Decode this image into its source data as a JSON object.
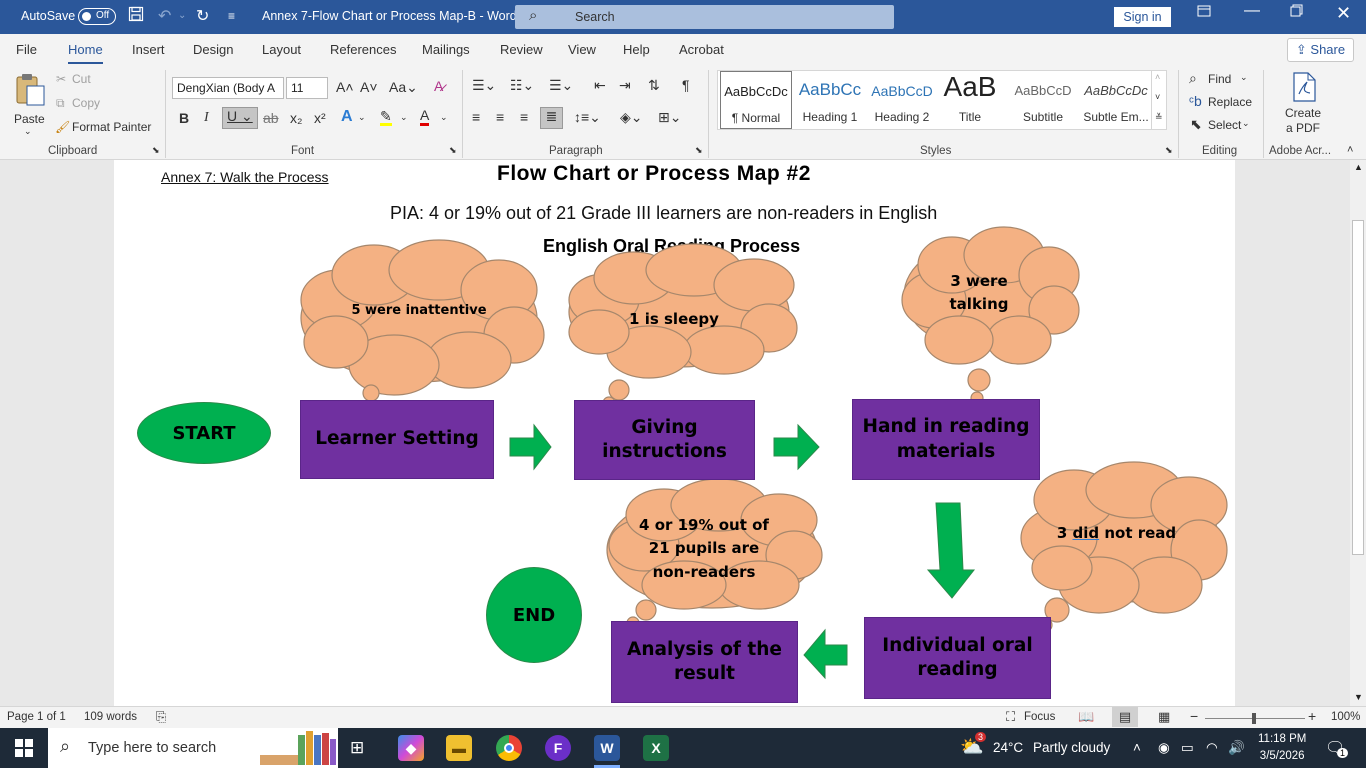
{
  "titlebar": {
    "autosave_label": "AutoSave",
    "autosave_state": "Off",
    "doc_title": "Annex 7-Flow Chart or Process Map-B  -  Word",
    "search_placeholder": "Search",
    "signin_label": "Sign in"
  },
  "menu": {
    "tabs": [
      "File",
      "Home",
      "Insert",
      "Design",
      "Layout",
      "References",
      "Mailings",
      "Review",
      "View",
      "Help",
      "Acrobat"
    ],
    "active": "Home",
    "share_label": "Share"
  },
  "ribbon": {
    "clipboard": {
      "paste": "Paste",
      "cut": "Cut",
      "copy": "Copy",
      "format_painter": "Format Painter",
      "label": "Clipboard"
    },
    "font": {
      "name": "DengXian (Body A",
      "size": "11",
      "label": "Font"
    },
    "paragraph": {
      "label": "Paragraph"
    },
    "styles": {
      "label": "Styles",
      "items": [
        {
          "sample": "AaBbCcDc",
          "name": "¶ Normal"
        },
        {
          "sample": "AaBbCc",
          "name": "Heading 1"
        },
        {
          "sample": "AaBbCcD",
          "name": "Heading 2"
        },
        {
          "sample": "AaB",
          "name": "Title"
        },
        {
          "sample": "AaBbCcD",
          "name": "Subtitle"
        },
        {
          "sample": "AaBbCcDc",
          "name": "Subtle Em..."
        }
      ]
    },
    "editing": {
      "find": "Find",
      "replace": "Replace",
      "select": "Select",
      "label": "Editing"
    },
    "adobe": {
      "create_line1": "Create",
      "create_line2": "a PDF",
      "label": "Adobe Acr..."
    }
  },
  "document": {
    "annex": "Annex 7: Walk the Process",
    "title": "Flow Chart or Process Map #2",
    "pia": "PIA: 4 or 19% out of 21 Grade III learners are non-readers in English",
    "subtitle": "English Oral Reading Process",
    "start": "START",
    "end": "END",
    "boxes": {
      "learner_setting": "Learner Setting",
      "giving_instructions_1": "Giving",
      "giving_instructions_2": "instructions",
      "hand_in_1": "Hand in reading",
      "hand_in_2": "materials",
      "individual_1": "Individual oral",
      "individual_2": "reading",
      "analysis_1": "Analysis of the",
      "analysis_2": "result"
    },
    "clouds": {
      "inattentive": "5 were inattentive",
      "sleepy": "1 is sleepy",
      "talking_1": "3 were",
      "talking_2": "talking",
      "did_not_read_num": "3",
      "did_not_read_word": "did",
      "did_not_read_rest": "not read",
      "result_1": "4 or 19% out of",
      "result_2": "21 pupils are",
      "result_3": "non-readers"
    },
    "colors": {
      "box": "#7030a0",
      "oval": "#00b050",
      "cloud": "#f4b183",
      "arrow": "#00b050"
    }
  },
  "statusbar": {
    "page": "Page 1 of 1",
    "words": "109 words",
    "focus": "Focus",
    "zoom": "100%"
  },
  "taskbar": {
    "search_placeholder": "Type here to search",
    "weather_temp": "24°C",
    "weather_desc": "Partly cloudy",
    "weather_badge": "3",
    "time": "11:18 PM",
    "date": "3/5/2026",
    "notif_count": "1"
  }
}
